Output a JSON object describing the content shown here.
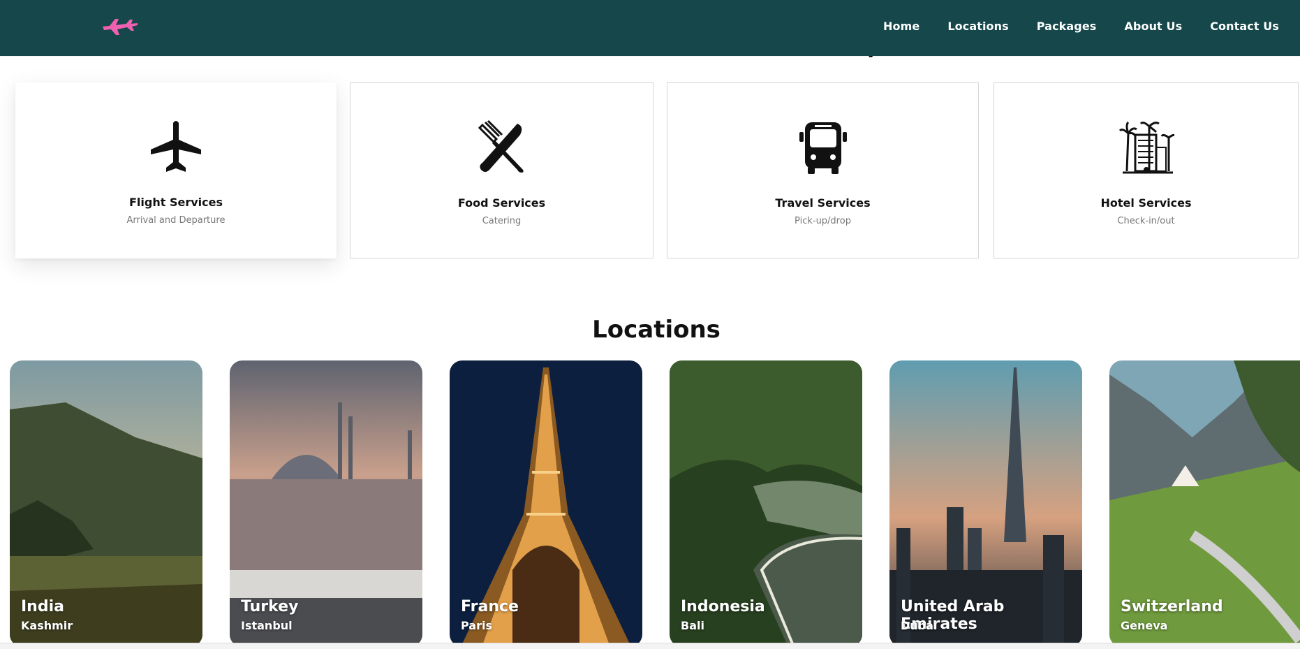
{
  "header": {
    "logo_icon": "airplane-logo-icon",
    "logo_color": "#f060b0",
    "background": "#16484b",
    "menu": [
      "Home",
      "Locations",
      "Packages",
      "About Us",
      "Contact Us"
    ]
  },
  "services": [
    {
      "title": "Flight Services",
      "subtitle": "Arrival and Departure",
      "icon": "airplane-icon"
    },
    {
      "title": "Food Services",
      "subtitle": "Catering",
      "icon": "fork-knife-icon"
    },
    {
      "title": "Travel Services",
      "subtitle": "Pick-up/drop",
      "icon": "bus-icon"
    },
    {
      "title": "Hotel Services",
      "subtitle": "Check-in/out",
      "icon": "hotel-icon"
    }
  ],
  "locations_section": {
    "title": "Locations",
    "items": [
      {
        "country": "India",
        "city": "Kashmir"
      },
      {
        "country": "Turkey",
        "city": "Istanbul"
      },
      {
        "country": "France",
        "city": "Paris"
      },
      {
        "country": "Indonesia",
        "city": "Bali"
      },
      {
        "country": "United Arab Emirates",
        "city": "Dubai"
      },
      {
        "country": "Switzerland",
        "city": "Geneva"
      }
    ]
  }
}
